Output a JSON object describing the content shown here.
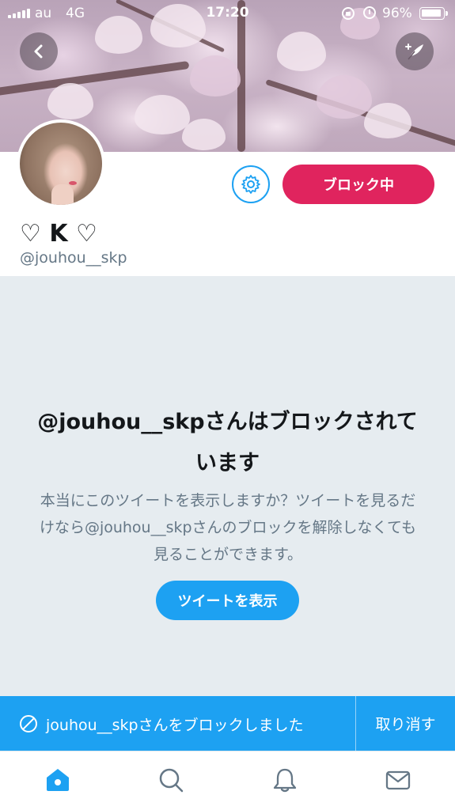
{
  "status_bar": {
    "carrier": "au",
    "network": "4G",
    "time": "17:20",
    "battery": "96%"
  },
  "profile": {
    "display_name": "♡ K ♡",
    "handle": "@jouhou__skp",
    "block_button_label": "ブロック中"
  },
  "blocked_notice": {
    "title": "@jouhou__skpさんはブロックされています",
    "description": "本当にこのツイートを表示しますか？ツイートを見るだけなら@jouhou__skpさんのブロックを解除しなくても見ることができます。",
    "view_button_label": "ツイートを表示"
  },
  "snackbar": {
    "message": "jouhou__skpさんをブロックしました",
    "undo_label": "取り消す"
  },
  "tab_bar": {
    "items": [
      {
        "icon": "home-icon",
        "active": true
      },
      {
        "icon": "search-icon",
        "active": false
      },
      {
        "icon": "bell-icon",
        "active": false
      },
      {
        "icon": "mail-icon",
        "active": false
      }
    ]
  },
  "colors": {
    "accent": "#1da1f2",
    "block_red": "#e0245e",
    "muted_text": "#657786",
    "blocked_bg": "#e6ecf0"
  }
}
